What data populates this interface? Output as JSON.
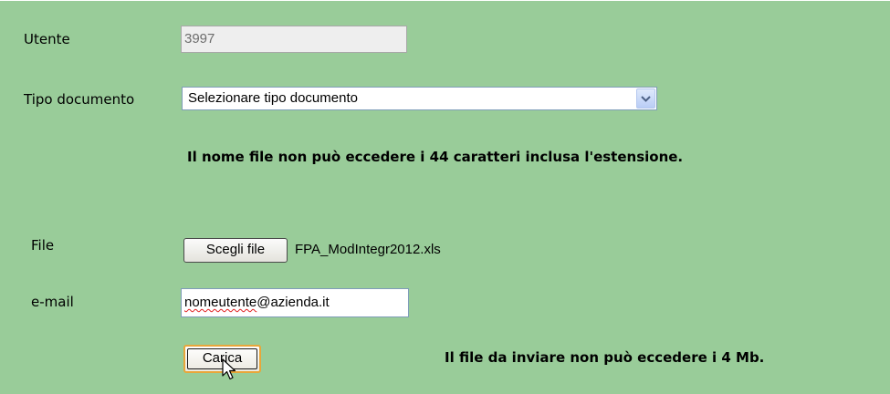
{
  "form": {
    "utente_label": "Utente",
    "utente_value": "3997",
    "tipo_label": "Tipo documento",
    "tipo_selected": "Selezionare tipo documento",
    "filename_note": "Il nome file non può eccedere i 44 caratteri inclusa l'estensione.",
    "file_label": "File",
    "choose_file_label": "Scegli file",
    "file_name": "FPA_ModIntegr2012.xls",
    "email_label": "e-mail",
    "email_user": "nomeutente",
    "email_domain": "@azienda.it",
    "upload_label": "Carica",
    "filesize_note": "Il file da inviare non può eccedere i 4 Mb."
  },
  "icons": {
    "dropdown": "chevron-down-icon",
    "cursor": "arrow-cursor-icon"
  },
  "colors": {
    "background": "#99cc99",
    "readonly_field": "#eeeeee",
    "focus_border": "#e8a63a",
    "spellcheck_underline": "#e02020"
  }
}
